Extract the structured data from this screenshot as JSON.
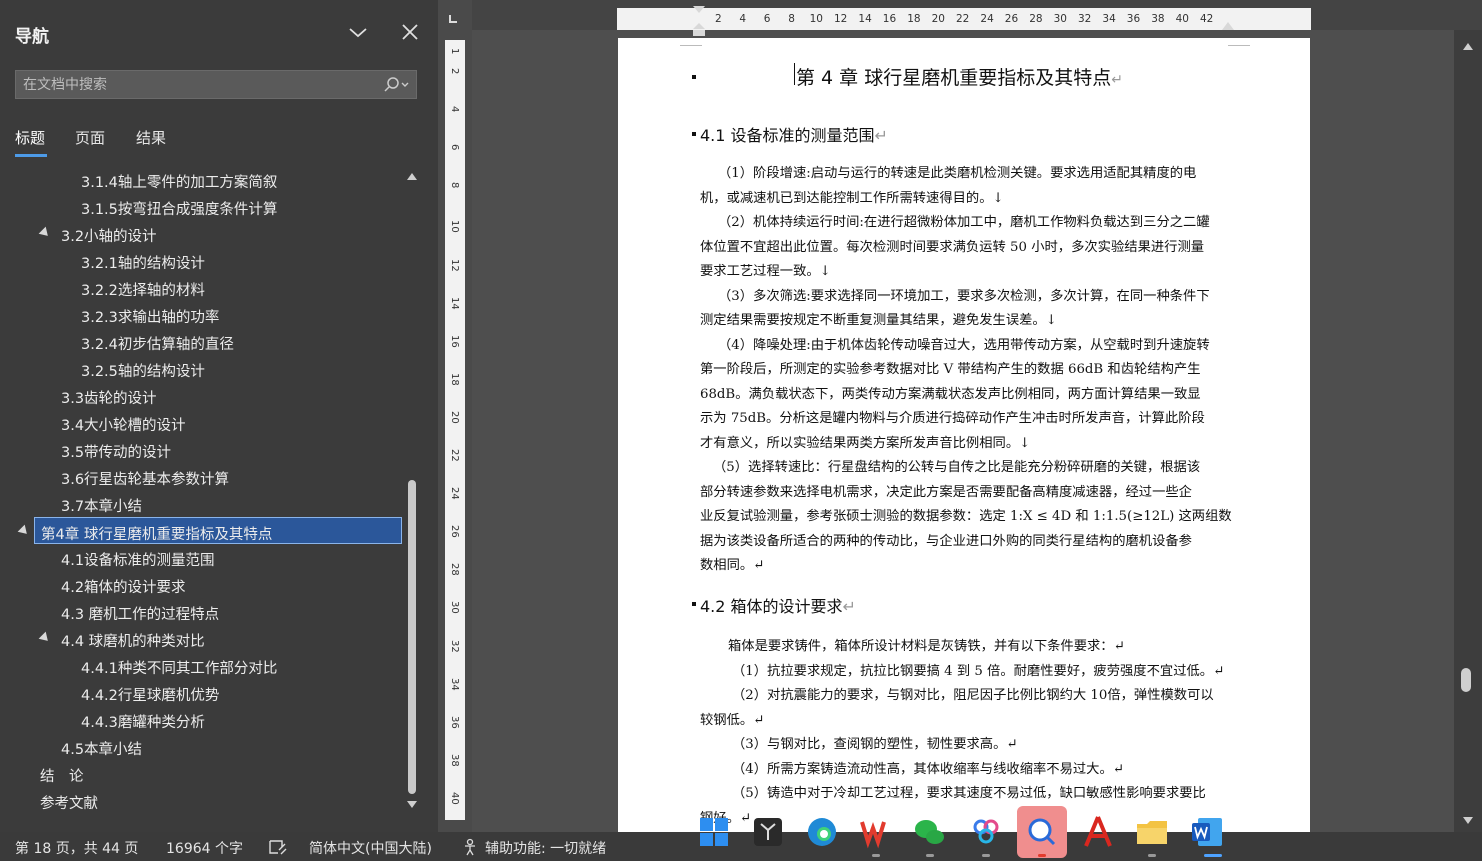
{
  "nav": {
    "title": "导航",
    "search_placeholder": "在文档中搜索",
    "tabs": [
      "标题",
      "页面",
      "结果"
    ],
    "tree": [
      {
        "label": "3.1.4轴上零件的加工方案简叙",
        "level": 3
      },
      {
        "label": "3.1.5按弯扭合成强度条件计算",
        "level": 3
      },
      {
        "label": "3.2小轴的设计",
        "level": 2,
        "expanded": true
      },
      {
        "label": "3.2.1轴的结构设计",
        "level": 3
      },
      {
        "label": "3.2.2选择轴的材料",
        "level": 3
      },
      {
        "label": "3.2.3求输出轴的功率",
        "level": 3
      },
      {
        "label": "3.2.4初步估算轴的直径",
        "level": 3
      },
      {
        "label": "3.2.5轴的结构设计",
        "level": 3
      },
      {
        "label": "3.3齿轮的设计",
        "level": 2
      },
      {
        "label": "3.4大小轮槽的设计",
        "level": 2
      },
      {
        "label": "3.5带传动的设计",
        "level": 2
      },
      {
        "label": "3.6行星齿轮基本参数计算",
        "level": 2
      },
      {
        "label": "3.7本章小结",
        "level": 2
      },
      {
        "label": "第4章 球行星磨机重要指标及其特点",
        "level": 1,
        "expanded": true,
        "selected": true
      },
      {
        "label": "4.1设备标准的测量范围",
        "level": 2
      },
      {
        "label": "4.2箱体的设计要求",
        "level": 2
      },
      {
        "label": "4.3 磨机工作的过程特点",
        "level": 2
      },
      {
        "label": "4.4 球磨机的种类对比",
        "level": 2,
        "expanded": true
      },
      {
        "label": "4.4.1种类不同其工作部分对比",
        "level": 3
      },
      {
        "label": "4.4.2行星球磨机优势",
        "level": 3
      },
      {
        "label": "4.4.3磨罐种类分析",
        "level": 3
      },
      {
        "label": "4.5本章小结",
        "level": 2
      },
      {
        "label": "结　论",
        "level": 1
      },
      {
        "label": "参考文献",
        "level": 1
      }
    ]
  },
  "ruler": {
    "h_numbers": [
      "2",
      "4",
      "6",
      "8",
      "10",
      "12",
      "14",
      "16",
      "18",
      "20",
      "22",
      "24",
      "26",
      "28",
      "30",
      "32",
      "34",
      "36",
      "38",
      "40",
      "42"
    ],
    "v_numbers": [
      "1",
      "2",
      "4",
      "6",
      "8",
      "10",
      "12",
      "14",
      "16",
      "18",
      "20",
      "22",
      "24",
      "26",
      "28",
      "30",
      "32",
      "34",
      "36",
      "38",
      "40"
    ]
  },
  "document": {
    "chapter_title": "第 4 章 球行星磨机重要指标及其特点",
    "sec1_title": "4.1 设备标准的测量范围",
    "sec1_paras": [
      [
        "（1）阶段增速:启动与运行的转速是此类磨机检测关键。要求选用适配其精度的电",
        "机，或减速机已到达能控制工作所需转速得目的。↓"
      ],
      [
        "（2）机体持续运行时间:在进行超微粉体加工中，磨机工作物料负载达到三分之二罐",
        "体位置不宜超出此位置。每次检测时间要求满负运转 50 小时，多次实验结果进行测量",
        "要求工艺过程一致。↓"
      ],
      [
        "（3）多次筛选:要求选择同一环境加工，要求多次检测，多次计算，在同一种条件下",
        "测定结果需要按规定不断重复测量其结果，避免发生误差。↓"
      ],
      [
        "（4）降噪处理:由于机体齿轮传动噪音过大，选用带传动方案，从空载时到升速旋转",
        "第一阶段后，所测定的实验参考数据对比 V 带结构产生的数据 66dB 和齿轮结构产生",
        "68dB。满负载状态下，两类传动方案满载状态发声比例相同，两方面计算结果一致显",
        "示为 75dB。分析这是罐内物料与介质进行捣碎动作产生冲击时所发声音，计算此阶段",
        "才有意义，所以实验结果两类方案所发声音比例相同。↓"
      ],
      [
        "（5）选择转速比：行星盘结构的公转与自传之比是能充分粉碎研磨的关键，根据该",
        "部分转速参数来选择电机需求，决定此方案是否需要配备高精度减速器，经过一些企",
        "业反复试验测量，参考张硕士测验的数据参数：选定 1:X ≤ 4D 和 1:1.5(≥12L) 这两组数",
        "据为该类设备所适合的两种的传动比，与企业进口外购的同类行星结构的磨机设备参",
        "数相同。↵"
      ]
    ],
    "sec2_title": "4.2 箱体的设计要求",
    "sec2_lines": [
      "箱体是要求铸件，箱体所设计材料是灰铸铁，并有以下条件要求：↵",
      "（1）抗拉要求规定，抗拉比钢要搞 4 到 5 倍。耐磨性要好，疲劳强度不宜过低。↵",
      "（2）对抗震能力的要求，与钢对比，阻尼因子比例比钢约大 10倍，弹性模数可以",
      "较钢低。↵",
      "（3）与钢对比，查阅钢的塑性，韧性要求高。↵",
      "（4）所需方案铸造流动性高，其体收缩率与线收缩率不易过大。↵",
      "（5）铸造中对于冷却工艺过程，要求其速度不易过低，缺口敏感性影响要求要比",
      "钢好。↵"
    ],
    "para_mark": "↵",
    "chapter_mark": "↵"
  },
  "status": {
    "page": "第 18 页，共 44 页",
    "words": "16964 个字",
    "language": "简体中文(中国大陆)",
    "accessibility": "辅助功能: 一切就绪"
  },
  "taskbar": {
    "icons": [
      "windows-start-icon",
      "app-dark-icon",
      "edge-icon",
      "wps-icon",
      "wechat-icon",
      "baidu-netdisk-icon",
      "search-chat-icon",
      "acrobat-icon",
      "file-explorer-icon",
      "word-icon"
    ]
  },
  "colors": {
    "nav_bg": "#3b3b3b",
    "selected": "#2b579a",
    "accent": "#4d9be8"
  }
}
